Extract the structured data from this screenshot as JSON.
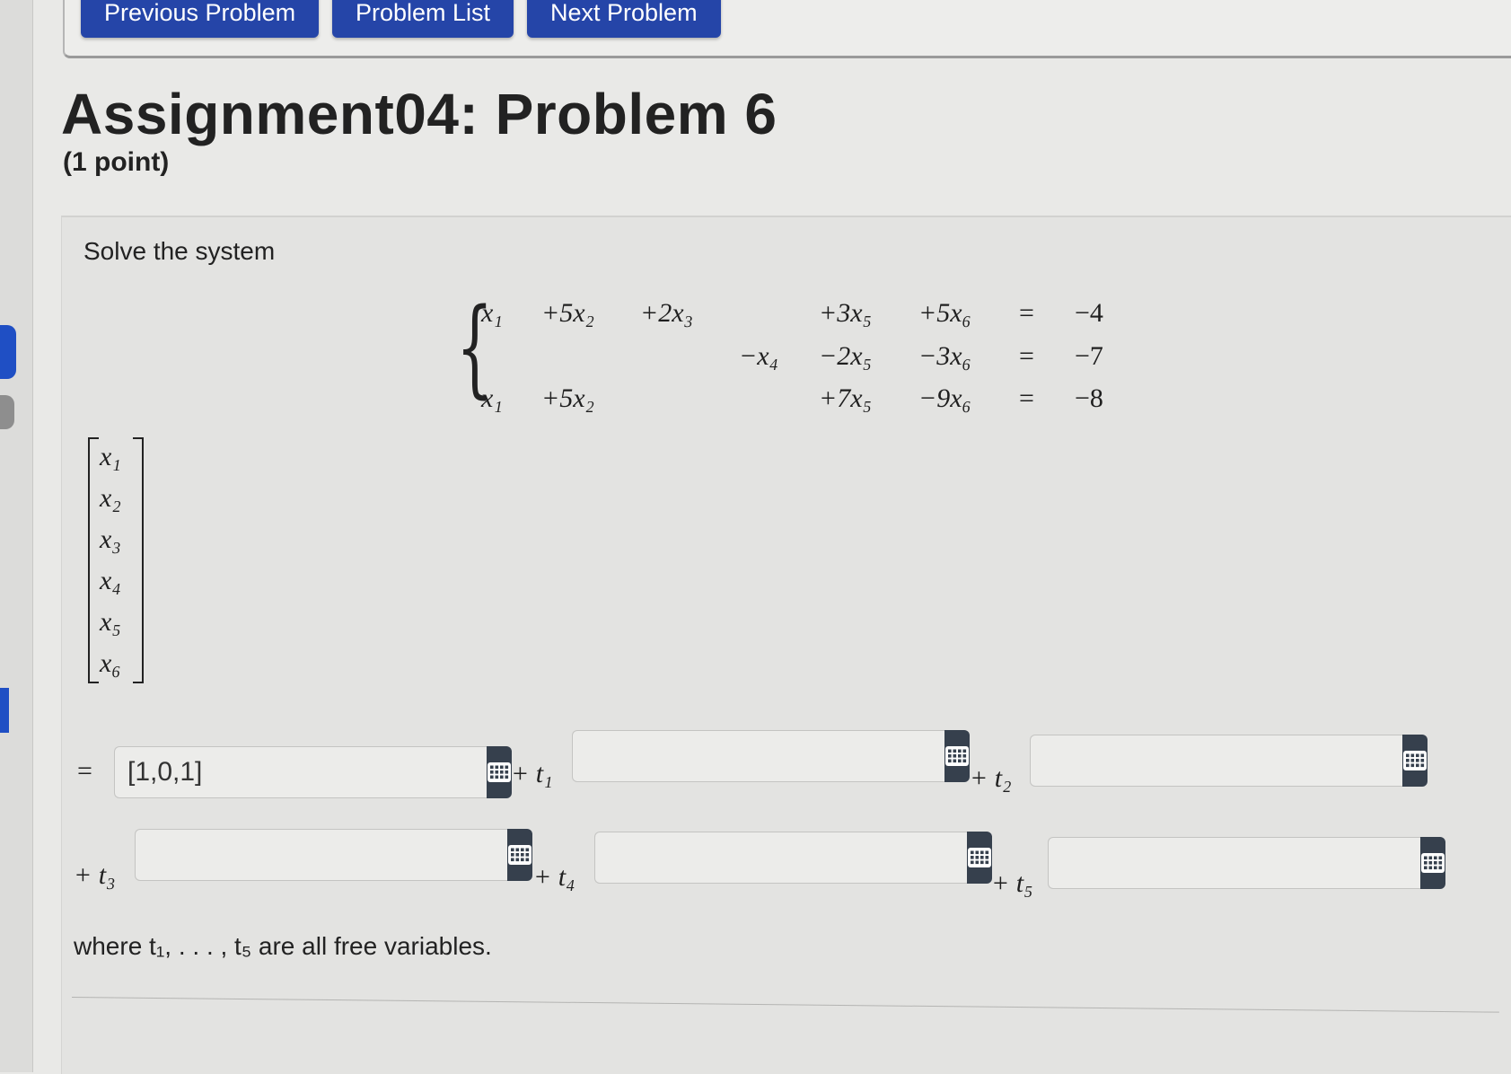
{
  "nav": {
    "previous_label": "Previous Problem",
    "list_label": "Problem List",
    "next_label": "Next Problem"
  },
  "header": {
    "title": "Assignment04: Problem 6",
    "points": "(1 point)"
  },
  "problem": {
    "prompt": "Solve the system",
    "system_rows": [
      [
        "x₁",
        "+5x₂",
        "+2x₃",
        "",
        "+3x₅",
        "+5x₆",
        "=",
        "−4"
      ],
      [
        "",
        "",
        "",
        "−x₄",
        "−2x₅",
        "−3x₆",
        "=",
        "−7"
      ],
      [
        "x₁",
        "+5x₂",
        "",
        "",
        "+7x₅",
        "−9x₆",
        "=",
        "−8"
      ]
    ],
    "unknowns_vector": [
      "x₁",
      "x₂",
      "x₃",
      "x₄",
      "x₅",
      "x₆"
    ],
    "equals_sign": "=",
    "answers": [
      {
        "prefix": "",
        "value": "[1,0,1]"
      },
      {
        "prefix": "+ t₁",
        "value": ""
      },
      {
        "prefix": "+ t₂",
        "value": ""
      },
      {
        "prefix": "+ t₃",
        "value": ""
      },
      {
        "prefix": "+ t₄",
        "value": ""
      },
      {
        "prefix": "+ t₅",
        "value": ""
      }
    ],
    "free_variables_note": "where t₁, . . . , t₅ are all free variables."
  },
  "icons": {
    "answer_palette": "grid-keypad-icon"
  },
  "colors": {
    "nav_button": "#2545a8",
    "palette_button": "#36404d",
    "left_tab_active": "#1f4fc4",
    "left_tab_inactive": "#8e8e8e"
  }
}
